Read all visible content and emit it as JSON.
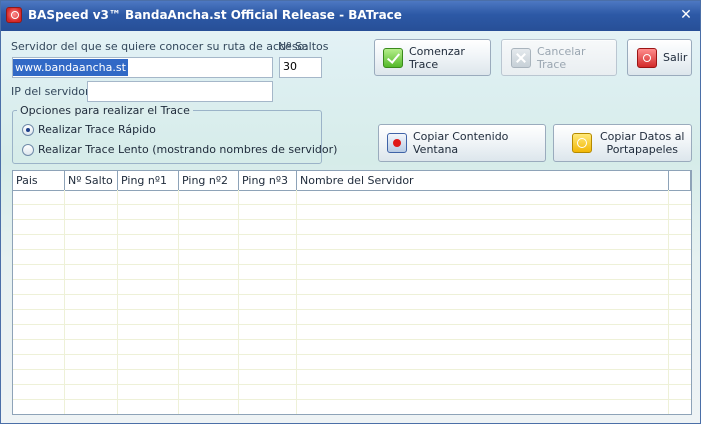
{
  "window": {
    "title": "BASpeed v3™ BandaAncha.st Official Release - BATrace"
  },
  "form": {
    "server_label": "Servidor del que se quiere conocer su ruta de acceso:",
    "hops_label": "Nº Saltos",
    "server_value": "www.bandaancha.st",
    "hops_value": "30",
    "ip_label": "IP del servidor",
    "ip_value": ""
  },
  "options": {
    "title": "Opciones para realizar el Trace",
    "items": [
      {
        "label": "Realizar Trace Rápido",
        "selected": true
      },
      {
        "label": "Realizar Trace Lento (mostrando nombres de servidor)",
        "selected": false
      }
    ]
  },
  "buttons": {
    "start": "Comenzar Trace",
    "cancel": "Cancelar Trace",
    "exit": "Salir",
    "copy_window": "Copiar Contenido Ventana",
    "copy_clipboard_line1": "Copiar Datos al",
    "copy_clipboard_line2": "Portapapeles"
  },
  "table": {
    "columns": [
      "Pais",
      "Nº Salto",
      "Ping nº1",
      "Ping nº2",
      "Ping nº3",
      "Nombre del Servidor",
      ""
    ],
    "rows": []
  },
  "icons": [
    "app-icon",
    "close-icon",
    "check-icon",
    "cancel-icon",
    "exit-icon",
    "record-icon",
    "clipboard-icon"
  ],
  "colors": {
    "title_bar": "#2d59a6",
    "selection": "#3169c6"
  }
}
